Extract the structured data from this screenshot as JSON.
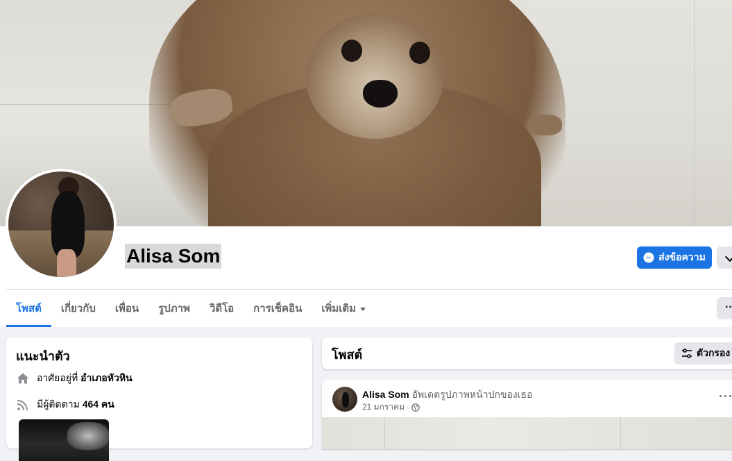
{
  "profile": {
    "name": "Alisa Som",
    "message_button": "ส่งข้อความ"
  },
  "tabs": [
    {
      "label": "โพสต์",
      "active": true
    },
    {
      "label": "เกี่ยวกับ",
      "active": false
    },
    {
      "label": "เพื่อน",
      "active": false
    },
    {
      "label": "รูปภาพ",
      "active": false
    },
    {
      "label": "วิดีโอ",
      "active": false
    },
    {
      "label": "การเช็คอิน",
      "active": false
    },
    {
      "label": "เพิ่มเติม",
      "active": false
    }
  ],
  "intro": {
    "title": "แนะนำตัว",
    "lives_prefix": "อาศัยอยู่ที่",
    "lives_place": "อำเภอหัวหิน",
    "followers_prefix": "มีผู้ติดตาม",
    "followers_count": "464 คน"
  },
  "posts": {
    "title": "โพสต์",
    "filter_button": "ตัวกรอง"
  },
  "post": {
    "author": "Alisa Som",
    "action": "อัพเดตรูปภาพหน้าปกของเธอ",
    "date": "21 มกราคม",
    "separator": "·"
  },
  "colors": {
    "accent": "#1b74e4",
    "secondary_button": "#e4e6eb",
    "page_bg": "#f0f2f5"
  },
  "icons": {
    "message": "messenger-icon",
    "home": "home-icon",
    "followers": "rss-icon",
    "filter": "sliders-icon",
    "privacy": "globe-icon"
  }
}
